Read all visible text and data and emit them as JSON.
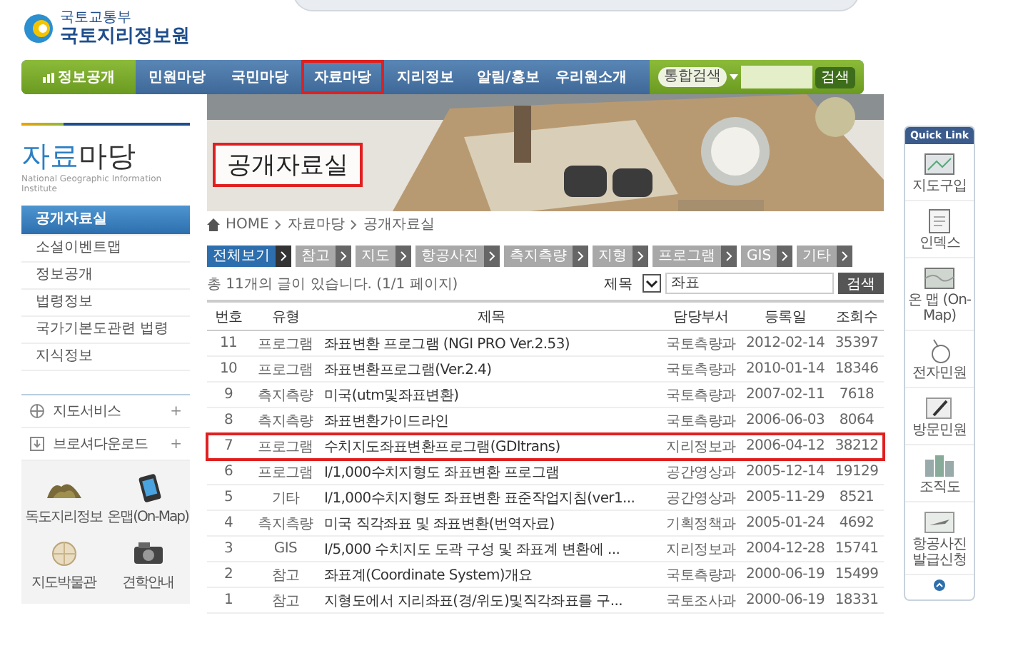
{
  "header": {
    "ministry": "국토교통부",
    "agency": "국토지리정보원"
  },
  "nav": {
    "home_item": "정보공개",
    "items": [
      {
        "label": "민원마당",
        "highlighted": false
      },
      {
        "label": "국민마당",
        "highlighted": false
      },
      {
        "label": "자료마당",
        "highlighted": true
      },
      {
        "label": "지리정보",
        "highlighted": false
      },
      {
        "label": "알림/홍보",
        "highlighted": false
      },
      {
        "label": "우리원소개",
        "highlighted": false
      }
    ],
    "search": {
      "scope": "통합검색",
      "button": "검색"
    }
  },
  "sidebar": {
    "title_accent": "자료",
    "title_rest": "마당",
    "subtitle": "National Geographic Information Institute",
    "items": [
      {
        "label": "공개자료실",
        "selected": true
      },
      {
        "label": "소셜이벤트맵",
        "selected": false
      },
      {
        "label": "정보공개",
        "selected": false
      },
      {
        "label": "법령정보",
        "selected": false
      },
      {
        "label": "국가기본도관련 법령",
        "selected": false
      },
      {
        "label": "지식정보",
        "selected": false
      }
    ],
    "services": [
      {
        "label": "지도서비스",
        "expander": "+"
      },
      {
        "label": "브로셔다운로드",
        "expander": "+"
      }
    ],
    "shortcuts": [
      {
        "label": "독도지리정보"
      },
      {
        "label": "온맵(On-Map)"
      },
      {
        "label": "지도박물관"
      },
      {
        "label": "견학안내"
      }
    ]
  },
  "page_title": {
    "text": "공개자료실",
    "highlighted": true
  },
  "breadcrumb": [
    "HOME",
    "자료마당",
    "공개자료실"
  ],
  "category_tabs": [
    {
      "label": "전체보기",
      "selected": true
    },
    {
      "label": "참고",
      "selected": false
    },
    {
      "label": "지도",
      "selected": false
    },
    {
      "label": "항공사진",
      "selected": false
    },
    {
      "label": "측지측량",
      "selected": false
    },
    {
      "label": "지형",
      "selected": false
    },
    {
      "label": "프로그램",
      "selected": false
    },
    {
      "label": "GIS",
      "selected": false
    },
    {
      "label": "기타",
      "selected": false
    }
  ],
  "summary": "총 11개의 글이 있습니다. (1/1 페이지)",
  "search": {
    "field": "제목",
    "value": "좌표",
    "button": "검색"
  },
  "table": {
    "columns": [
      "번호",
      "유형",
      "제목",
      "담당부서",
      "등록일",
      "조회수"
    ],
    "rows": [
      {
        "cells": [
          "11",
          "프로그램",
          "좌표변환 프로그램 (NGI PRO Ver.2.53)",
          "국토측량과",
          "2012-02-14",
          "35397"
        ],
        "highlighted": false
      },
      {
        "cells": [
          "10",
          "프로그램",
          "좌표변환프로그램(Ver.2.4)",
          "국토측량과",
          "2010-01-14",
          "18346"
        ],
        "highlighted": false
      },
      {
        "cells": [
          "9",
          "측지측량",
          "미국(utm및좌표변환)",
          "국토측량과",
          "2007-02-11",
          "7618"
        ],
        "highlighted": false
      },
      {
        "cells": [
          "8",
          "측지측량",
          "좌표변환가이드라인",
          "국토측량과",
          "2006-06-03",
          "8064"
        ],
        "highlighted": false
      },
      {
        "cells": [
          "7",
          "프로그램",
          "수치지도좌표변환프로그램(GDItrans)",
          "지리정보과",
          "2006-04-12",
          "38212"
        ],
        "highlighted": true
      },
      {
        "cells": [
          "6",
          "프로그램",
          "I/1,000수치지형도 좌표변환 프로그램",
          "공간영상과",
          "2005-12-14",
          "19129"
        ],
        "highlighted": false
      },
      {
        "cells": [
          "5",
          "기타",
          "I/1,000수치지형도 좌표변환 표준작업지침(ver1...",
          "공간영상과",
          "2005-11-29",
          "8521"
        ],
        "highlighted": false
      },
      {
        "cells": [
          "4",
          "측지측량",
          "미국 직각좌표 및 좌표변환(번역자료)",
          "기획정책과",
          "2005-01-24",
          "4692"
        ],
        "highlighted": false
      },
      {
        "cells": [
          "3",
          "GIS",
          "I/5,000 수치지도 도곽 구성 및 좌표계 변환에 ...",
          "지리정보과",
          "2004-12-28",
          "15741"
        ],
        "highlighted": false
      },
      {
        "cells": [
          "2",
          "참고",
          "좌표계(Coordinate System)개요",
          "국토측량과",
          "2000-06-19",
          "15499"
        ],
        "highlighted": false
      },
      {
        "cells": [
          "1",
          "참고",
          "지형도에서 지리좌표(경/위도)및직각좌표를 구...",
          "국토조사과",
          "2000-06-19",
          "18331"
        ],
        "highlighted": false
      }
    ]
  },
  "quick_link": {
    "title": "Quick Link",
    "items": [
      {
        "label": "지도구입"
      },
      {
        "label": "인덱스"
      },
      {
        "label": "온 맵 (On-Map)"
      },
      {
        "label": "전자민원"
      },
      {
        "label": "방문민원"
      },
      {
        "label": "조직도"
      },
      {
        "label": "항공사진 발급신청"
      }
    ]
  }
}
